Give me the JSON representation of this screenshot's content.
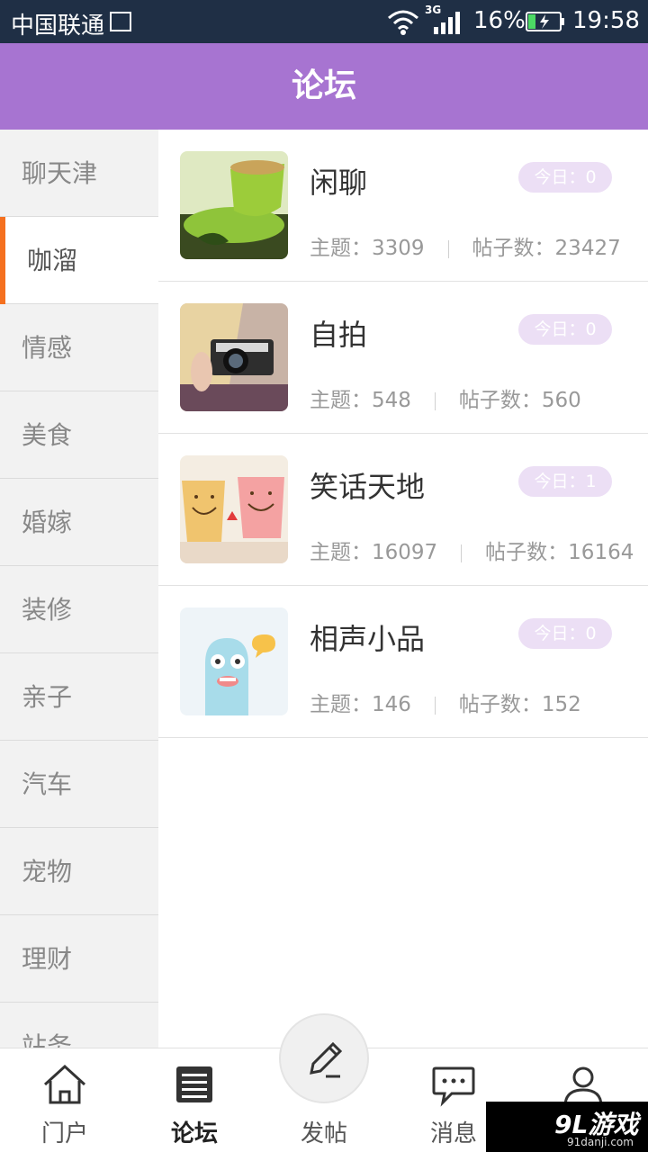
{
  "status_bar": {
    "carrier": "中国联通",
    "network": "3G",
    "battery": "16%",
    "time": "19:58"
  },
  "header": {
    "title": "论坛"
  },
  "sidebar": {
    "items": [
      {
        "label": "聊天津",
        "active": false
      },
      {
        "label": "咖溜",
        "active": true
      },
      {
        "label": "情感",
        "active": false
      },
      {
        "label": "美食",
        "active": false
      },
      {
        "label": "婚嫁",
        "active": false
      },
      {
        "label": "装修",
        "active": false
      },
      {
        "label": "亲子",
        "active": false
      },
      {
        "label": "汽车",
        "active": false
      },
      {
        "label": "宠物",
        "active": false
      },
      {
        "label": "理财",
        "active": false
      },
      {
        "label": "站务",
        "active": false
      }
    ]
  },
  "forums": [
    {
      "name": "闲聊",
      "today": "今日：0",
      "topics": "主题：3309",
      "posts": "帖子数：23427",
      "thumb_icon": "green-tea-cup-photo"
    },
    {
      "name": "自拍",
      "today": "今日：0",
      "topics": "主题：548",
      "posts": "帖子数：560",
      "thumb_icon": "girl-with-camera-photo"
    },
    {
      "name": "笑话天地",
      "today": "今日：1",
      "topics": "主题：16097",
      "posts": "帖子数：16164",
      "thumb_icon": "smiley-cups-photo"
    },
    {
      "name": "相声小品",
      "today": "今日：0",
      "topics": "主题：146",
      "posts": "帖子数：152",
      "thumb_icon": "blue-monster-hi-illustration"
    }
  ],
  "tabbar": {
    "tabs": [
      {
        "label": "门户",
        "icon": "home-icon"
      },
      {
        "label": "论坛",
        "icon": "book-icon",
        "active": true
      },
      {
        "label": "发帖",
        "icon": "pencil-icon"
      },
      {
        "label": "消息",
        "icon": "chat-bubble-icon"
      },
      {
        "label": "",
        "icon": "user-icon"
      }
    ]
  },
  "watermark": {
    "logo": "9L游戏",
    "site": "91danji.com"
  },
  "colors": {
    "header_bg": "#a774d1",
    "statusbar_bg": "#1f2f45",
    "active_indicator": "#f5701f",
    "badge_bg": "#ecdff5"
  }
}
